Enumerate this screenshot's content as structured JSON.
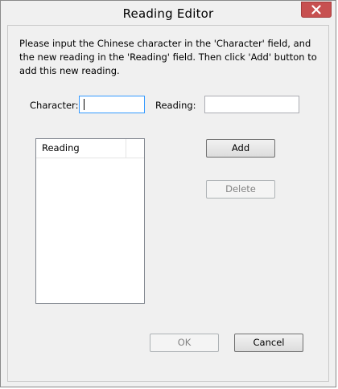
{
  "window": {
    "title": "Reading Editor"
  },
  "instructions": "Please input the Chinese character in the 'Character' field, and the new reading in the 'Reading' field. Then click 'Add' button to add this new reading.",
  "fields": {
    "character_label": "Character:",
    "character_value": "",
    "reading_label": "Reading:",
    "reading_value": ""
  },
  "list": {
    "columns": [
      "Reading"
    ],
    "rows": []
  },
  "buttons": {
    "add": "Add",
    "delete": "Delete",
    "ok": "OK",
    "cancel": "Cancel"
  },
  "icons": {
    "close": "close-x-icon"
  },
  "colors": {
    "close_button": "#c75050",
    "focus_border": "#3399ff"
  }
}
